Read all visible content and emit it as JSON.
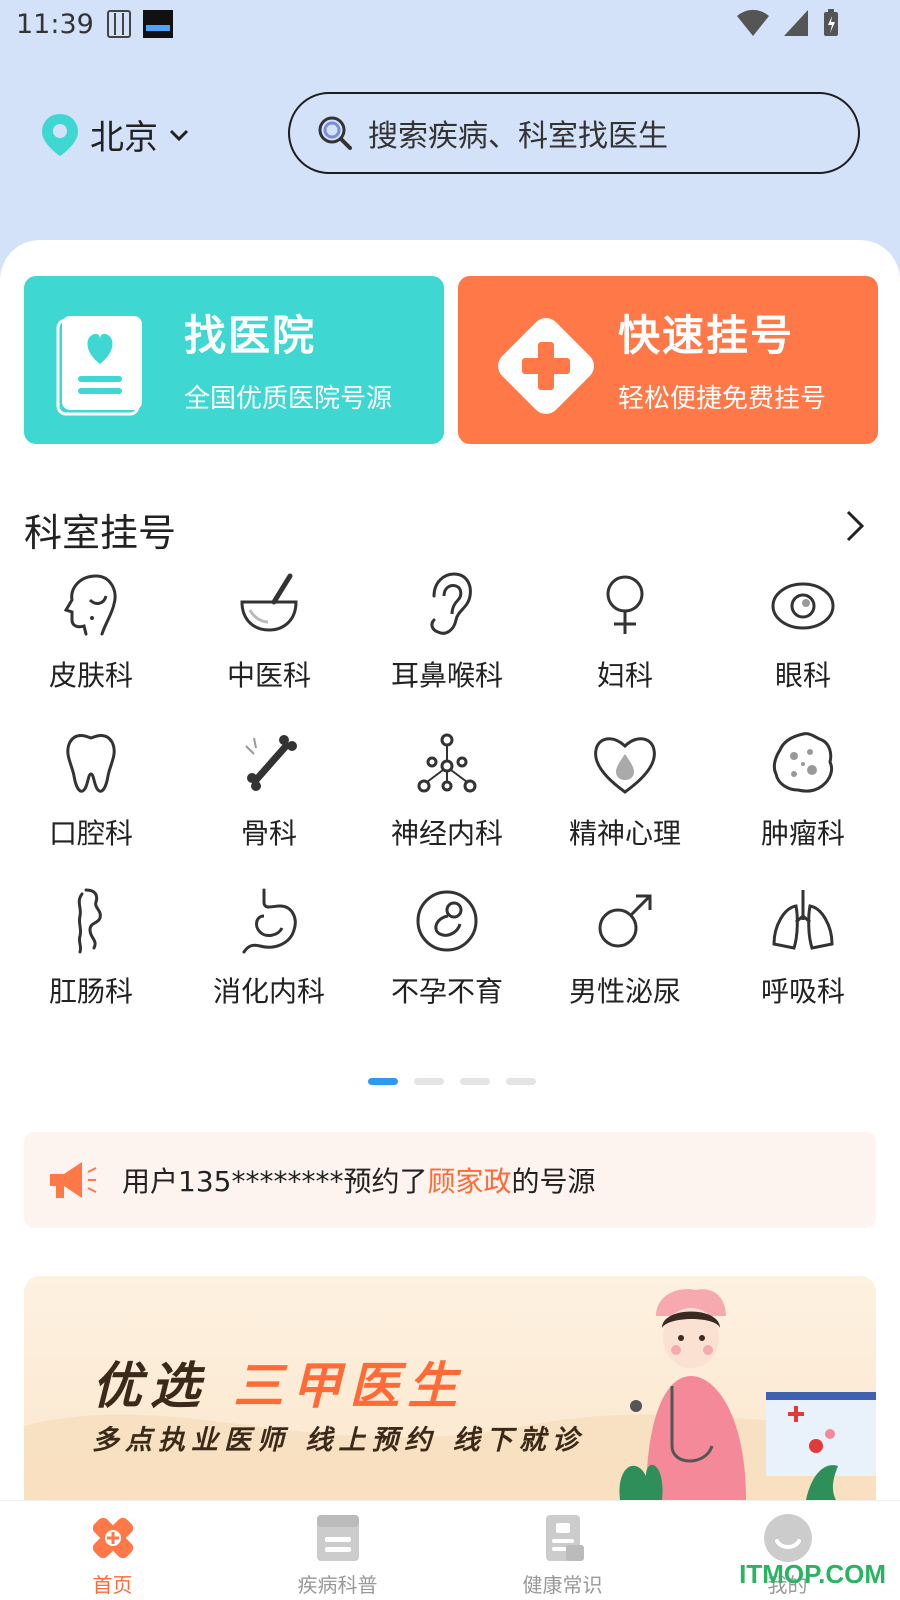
{
  "status": {
    "time": "11:39"
  },
  "header": {
    "city": "北京",
    "search_placeholder": "搜索疾病、科室找医生"
  },
  "actions": [
    {
      "title": "找医院",
      "subtitle": "全国优质医院号源"
    },
    {
      "title": "快速挂号",
      "subtitle": "轻松便捷免费挂号"
    }
  ],
  "section": {
    "title": "科室挂号"
  },
  "departments": [
    {
      "label": "皮肤科",
      "icon": "skin-icon"
    },
    {
      "label": "中医科",
      "icon": "mortar-icon"
    },
    {
      "label": "耳鼻喉科",
      "icon": "ear-icon"
    },
    {
      "label": "妇科",
      "icon": "female-icon"
    },
    {
      "label": "眼科",
      "icon": "eye-icon"
    },
    {
      "label": "口腔科",
      "icon": "tooth-icon"
    },
    {
      "label": "骨科",
      "icon": "bone-icon"
    },
    {
      "label": "神经内科",
      "icon": "neuron-icon"
    },
    {
      "label": "精神心理",
      "icon": "heart-drop-icon"
    },
    {
      "label": "肿瘤科",
      "icon": "tumor-icon"
    },
    {
      "label": "肛肠科",
      "icon": "intestine-icon"
    },
    {
      "label": "消化内科",
      "icon": "stomach-icon"
    },
    {
      "label": "不孕不育",
      "icon": "fetus-icon"
    },
    {
      "label": "男性泌尿",
      "icon": "male-icon"
    },
    {
      "label": "呼吸科",
      "icon": "lungs-icon"
    }
  ],
  "pager": {
    "pages": 4,
    "active": 0
  },
  "notice": {
    "prefix": "用户135********预约了",
    "highlight": "顾家政",
    "suffix": "的号源"
  },
  "banner": {
    "title_part1": "优选",
    "title_part2": "三甲医生",
    "subtitle": "多点执业医师 线上预约 线下就诊"
  },
  "tabs": [
    {
      "label": "首页",
      "active": true
    },
    {
      "label": "疾病科普",
      "active": false
    },
    {
      "label": "健康常识",
      "active": false
    },
    {
      "label": "我的",
      "active": false
    }
  ],
  "watermark": "ITMOP.COM",
  "colors": {
    "teal": "#3fd7d2",
    "orange": "#ff7847",
    "accent": "#ff6a36",
    "page_bg": "#d4e2f9"
  }
}
